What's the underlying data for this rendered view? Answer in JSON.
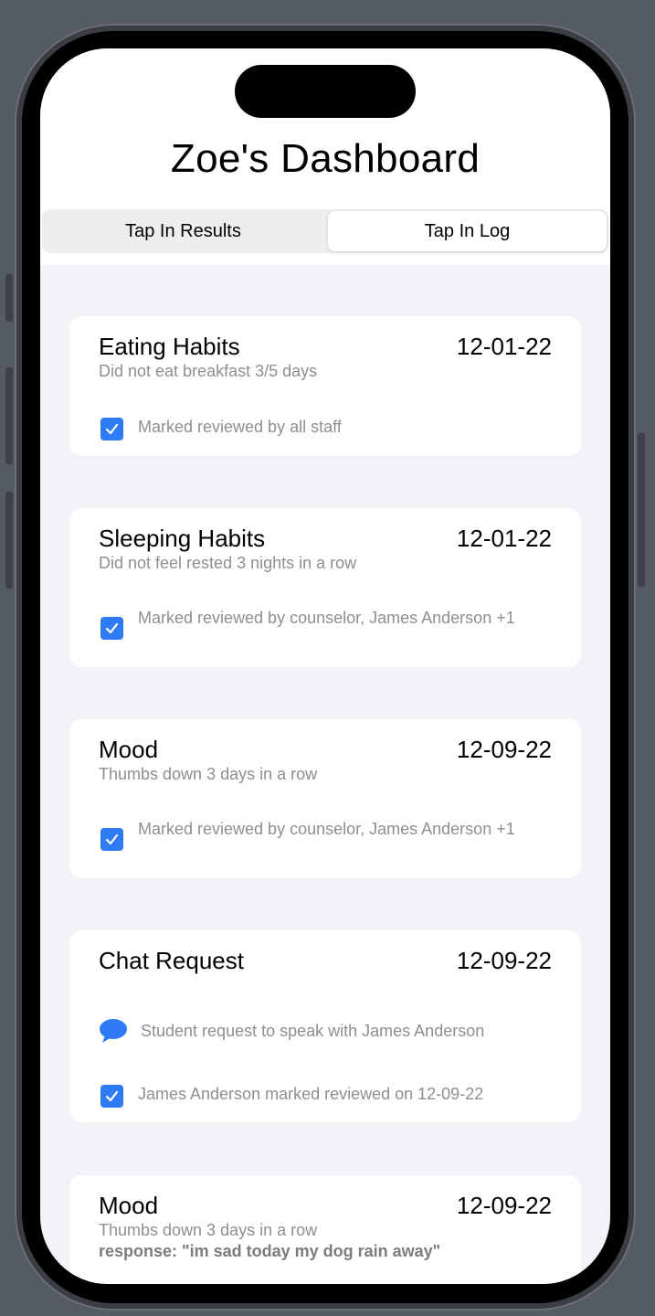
{
  "app": {
    "title": "Zoe's Dashboard"
  },
  "tabs": [
    {
      "label": "Tap In Results",
      "selected": false
    },
    {
      "label": "Tap In Log",
      "selected": true
    }
  ],
  "colors": {
    "accent": "#2f7bf5",
    "card": "#ffffff",
    "background": "#f2f2f7",
    "secondary_text": "#8e8e93"
  },
  "cards": [
    {
      "title": "Eating Habits",
      "date": "12-01-22",
      "subtitle": "Did not eat breakfast 3/5 days",
      "reviewed": "Marked reviewed by all staff"
    },
    {
      "title": "Sleeping Habits",
      "date": "12-01-22",
      "subtitle": "Did not feel rested 3 nights in a row",
      "reviewed": "Marked reviewed by counselor, James Anderson +1"
    },
    {
      "title": "Mood",
      "date": "12-09-22",
      "subtitle": "Thumbs down 3 days in a row",
      "reviewed": "Marked reviewed by counselor, James Anderson +1"
    },
    {
      "title": "Chat Request",
      "date": "12-09-22",
      "chat": "Student request to speak with James Anderson",
      "reviewed": "James Anderson marked reviewed on 12-09-22"
    },
    {
      "title": "Mood",
      "date": "12-09-22",
      "subtitle": "Thumbs down 3 days in a row",
      "response": "response: \"im sad today my dog rain away\""
    }
  ],
  "icons": {
    "check": "checkbox-checked-icon",
    "chat": "chat-bubble-icon"
  }
}
